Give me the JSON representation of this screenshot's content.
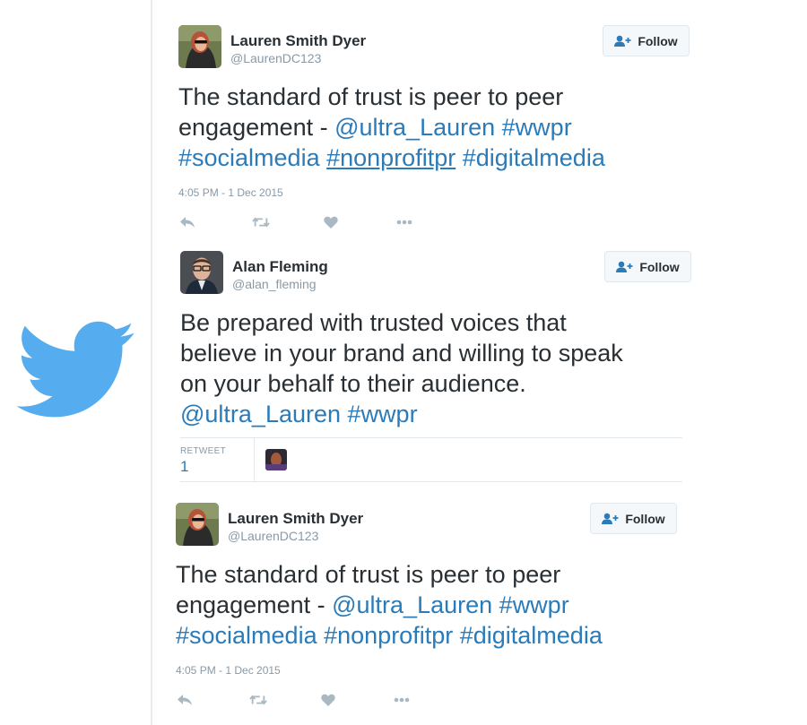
{
  "tweets": [
    {
      "name": "Lauren Smith Dyer",
      "handle": "@LaurenDC123",
      "follow_label": "Follow",
      "text": [
        {
          "t": "The standard of trust is peer to peer"
        },
        {
          "t": "engagement - "
        },
        {
          "t": "@ultra_Lauren",
          "link": true
        },
        {
          "t": " "
        },
        {
          "t": "#wwpr",
          "link": true
        },
        {
          "t": "#socialmedia",
          "link": true
        },
        {
          "t": " "
        },
        {
          "t": "#nonprofitpr",
          "link": true
        },
        {
          "t": " "
        },
        {
          "t": "#digitalmedia",
          "link": true
        }
      ],
      "timestamp": "4:05 PM - 1 Dec 2015"
    },
    {
      "name": "Alan Fleming",
      "handle": "@alan_fleming",
      "follow_label": "Follow",
      "text": [
        {
          "t": "Be prepared with trusted voices that"
        },
        {
          "t": "believe in your brand and willing to speak"
        },
        {
          "t": "on your behalf to their audience."
        },
        {
          "t": "@ultra_Lauren",
          "link": true
        },
        {
          "t": " "
        },
        {
          "t": "#wwpr",
          "link": true
        }
      ],
      "retweet_label": "RETWEET",
      "retweet_count": "1"
    },
    {
      "name": "Lauren Smith Dyer",
      "handle": "@LaurenDC123",
      "follow_label": "Follow",
      "text": [
        {
          "t": "The standard of trust is peer to peer"
        },
        {
          "t": "engagement - "
        },
        {
          "t": "@ultra_Lauren",
          "link": true
        },
        {
          "t": " "
        },
        {
          "t": "#wwpr",
          "link": true
        },
        {
          "t": "#socialmedia",
          "link": true
        },
        {
          "t": " "
        },
        {
          "t": "#nonprofitpr",
          "link": true
        },
        {
          "t": " "
        },
        {
          "t": "#digitalmedia",
          "link": true
        }
      ],
      "timestamp": "4:05 PM - 1 Dec 2015"
    }
  ],
  "icons": {
    "logo": "twitter-bird-icon",
    "follow": "add-user-icon",
    "reply": "reply-icon",
    "retweet": "retweet-icon",
    "like": "heart-icon",
    "more": "more-icon"
  },
  "colors": {
    "brand": "#55acee",
    "link": "#2b7bb9",
    "text": "#292f33",
    "muted": "#8899a6"
  }
}
